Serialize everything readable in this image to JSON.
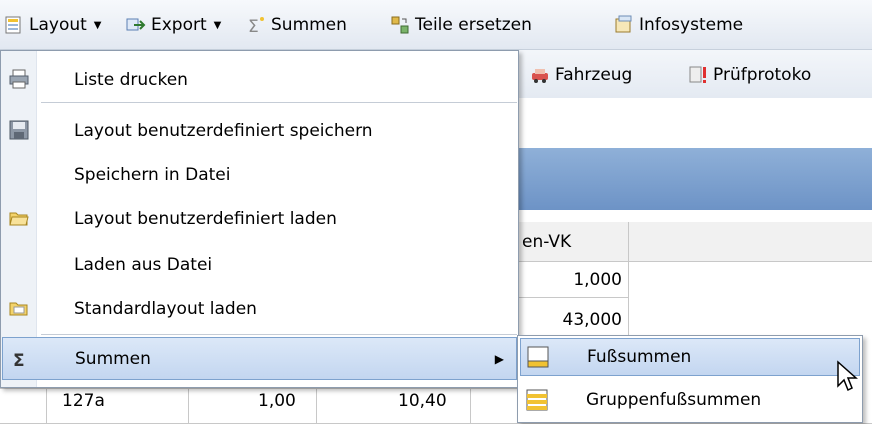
{
  "toolbar": {
    "layout_label": "Layout",
    "export_label": "Export",
    "summen_label": "Summen",
    "teile_label": "Teile ersetzen",
    "info_label": "Infosysteme",
    "fahrzeug_label": "Fahrzeug",
    "pruef_label": "Prüfprotoko"
  },
  "grid": {
    "header_partial": "en-VK",
    "values": [
      "1,000",
      "43,000"
    ],
    "row": {
      "c1": "127a",
      "c2": "1,00",
      "c3": "10,40"
    }
  },
  "menu": {
    "items": [
      {
        "label": "Liste drucken",
        "icon": "print-icon"
      },
      {
        "label": "Layout benutzerdefiniert speichern",
        "icon": "save-icon"
      },
      {
        "label": "Speichern in Datei",
        "icon": ""
      },
      {
        "label": "Layout benutzerdefiniert laden",
        "icon": "folder-open-icon"
      },
      {
        "label": "Laden aus Datei",
        "icon": ""
      },
      {
        "label": "Standardlayout laden",
        "icon": "folder-icon"
      },
      {
        "label": "Summen",
        "icon": "sigma-icon"
      }
    ]
  },
  "submenu": {
    "items": [
      {
        "label": "Fußsummen",
        "icon": "footer-sum-icon"
      },
      {
        "label": "Gruppenfußsummen",
        "icon": "group-footer-sum-icon"
      }
    ]
  }
}
